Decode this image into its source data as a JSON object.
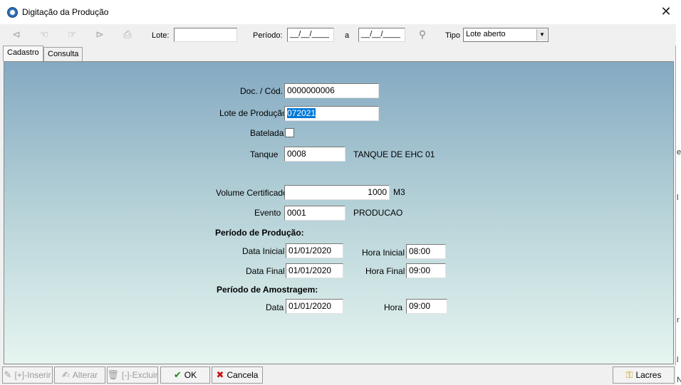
{
  "window": {
    "title": "Digitação da Produção",
    "close_glyph": "✕"
  },
  "toolbar": {
    "lote_label": "Lote:",
    "lote_value": "",
    "periodo_label": "Período:",
    "periodo_start": "__/__/____",
    "periodo_sep": "a",
    "periodo_end": "__/__/____",
    "tipo_label": "Tipo",
    "tipo_value": "Lote aberto"
  },
  "tabs": [
    {
      "label": "Cadastro",
      "active": true
    },
    {
      "label": "Consulta",
      "active": false
    }
  ],
  "form": {
    "doc_label": "Doc. / Cód.",
    "doc_value": "0000000006",
    "lote_label": "Lote de Produção",
    "lote_value": "072021",
    "batelada_label": "Batelada",
    "batelada_checked": false,
    "tanque_label": "Tanque",
    "tanque_value": "0008",
    "tanque_desc": "TANQUE DE EHC 01",
    "volume_label": "Volume Certificado",
    "volume_value": "1000",
    "volume_unit": "M3",
    "evento_label": "Evento",
    "evento_value": "0001",
    "evento_desc": "PRODUCAO",
    "periodo_producao_heading": "Período de Produção:",
    "data_inicial_label": "Data Inicial",
    "data_inicial_value": "01/01/2020",
    "hora_inicial_label": "Hora Inicial",
    "hora_inicial_value": "08:00",
    "data_final_label": "Data Final",
    "data_final_value": "01/01/2020",
    "hora_final_label": "Hora Final",
    "hora_final_value": "09:00",
    "periodo_amostragem_heading": "Período de Amostragem:",
    "data_label": "Data",
    "data_value": "01/01/2020",
    "hora_label": "Hora",
    "hora_value": "09:00"
  },
  "bottom": {
    "inserir": "[+]-Inserir",
    "alterar": "Alterar",
    "excluir": "[-]-Excluir",
    "ok": "OK",
    "cancela": "Cancela",
    "lacres": "Lacres"
  },
  "edge_chars": [
    "e",
    "l",
    "r",
    "l",
    "N"
  ]
}
